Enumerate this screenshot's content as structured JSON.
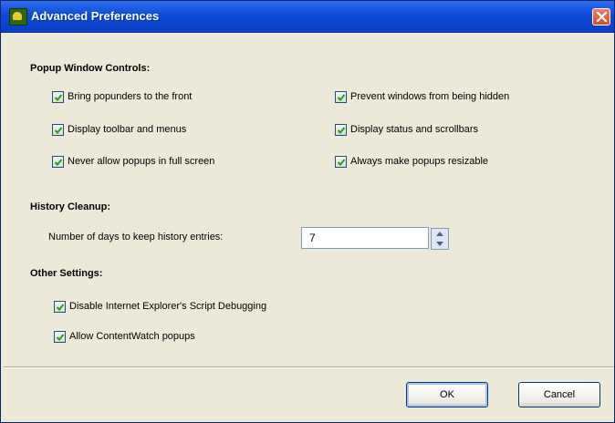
{
  "window": {
    "title": "Advanced Preferences"
  },
  "popup_controls": {
    "heading": "Popup Window Controls:",
    "left_items": [
      {
        "label": "Bring popunders to the front",
        "checked": true
      },
      {
        "label": "Display toolbar and menus",
        "checked": true
      },
      {
        "label": "Never allow popups in full screen",
        "checked": true
      }
    ],
    "right_items": [
      {
        "label": "Prevent windows from being hidden",
        "checked": true
      },
      {
        "label": "Display status and scrollbars",
        "checked": true
      },
      {
        "label": "Always make popups resizable",
        "checked": true
      }
    ]
  },
  "history": {
    "heading": "History Cleanup:",
    "label": "Number of days to keep history entries:",
    "days_value": "7"
  },
  "other": {
    "heading": "Other Settings:",
    "items": [
      {
        "label": "Disable Internet Explorer's Script Debugging",
        "checked": true
      },
      {
        "label": "Allow ContentWatch popups",
        "checked": true
      }
    ]
  },
  "buttons": {
    "ok_label": "OK",
    "cancel_label": "Cancel"
  },
  "colors": {
    "titlebar": "#0d4ad8",
    "check_green": "#21a121",
    "face": "#ece9d8"
  },
  "icons": {
    "title": "app-shield-icon",
    "close": "close-icon",
    "check": "checkmark-icon",
    "spin_up": "spin-up-arrow-icon",
    "spin_down": "spin-down-arrow-icon"
  }
}
